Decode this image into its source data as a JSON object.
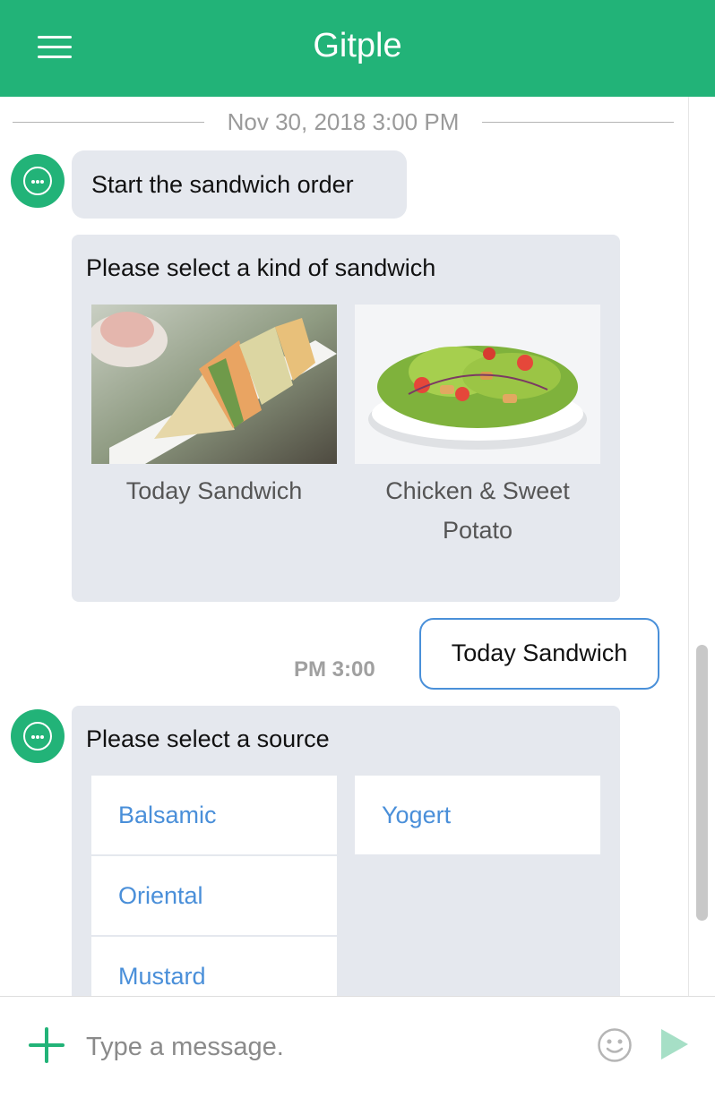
{
  "header": {
    "title": "Gitple"
  },
  "date_separator": "Nov 30, 2018 3:00 PM",
  "messages": {
    "start": "Start the sandwich order",
    "sandwich_card": {
      "title": "Please select a kind of sandwich",
      "items": [
        {
          "label": "Today Sandwich"
        },
        {
          "label": "Chicken & Sweet Potato"
        }
      ]
    },
    "user_reply": {
      "text": "Today Sandwich",
      "time": "PM 3:00"
    },
    "source_card": {
      "title": "Please select a source",
      "options": [
        "Balsamic",
        "Oriental",
        "Mustard",
        "Yogert"
      ]
    }
  },
  "composer": {
    "placeholder": "Type a message."
  },
  "colors": {
    "brand": "#22b378",
    "bubble": "#e5e8ee",
    "link": "#4a8fd9",
    "reply_border": "#4a90d9"
  },
  "icons": [
    "menu-icon",
    "bot-avatar-icon",
    "plus-icon",
    "emoji-icon",
    "send-icon"
  ]
}
